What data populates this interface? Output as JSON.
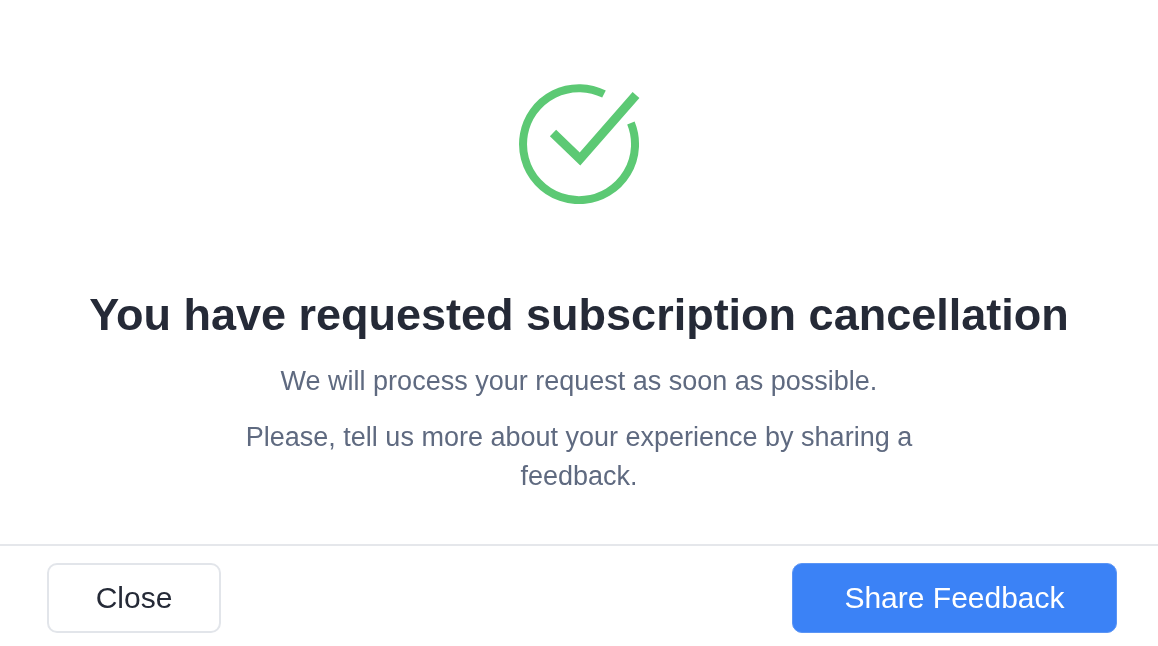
{
  "title": "You have requested subscription cancellation",
  "messages": [
    "We will process your request as soon as possible.",
    "Please, tell us more about your experience by sharing a feedback."
  ],
  "buttons": [
    {
      "label": "Close",
      "kind": "secondary"
    },
    {
      "label": "Share Feedback",
      "kind": "primary"
    }
  ]
}
